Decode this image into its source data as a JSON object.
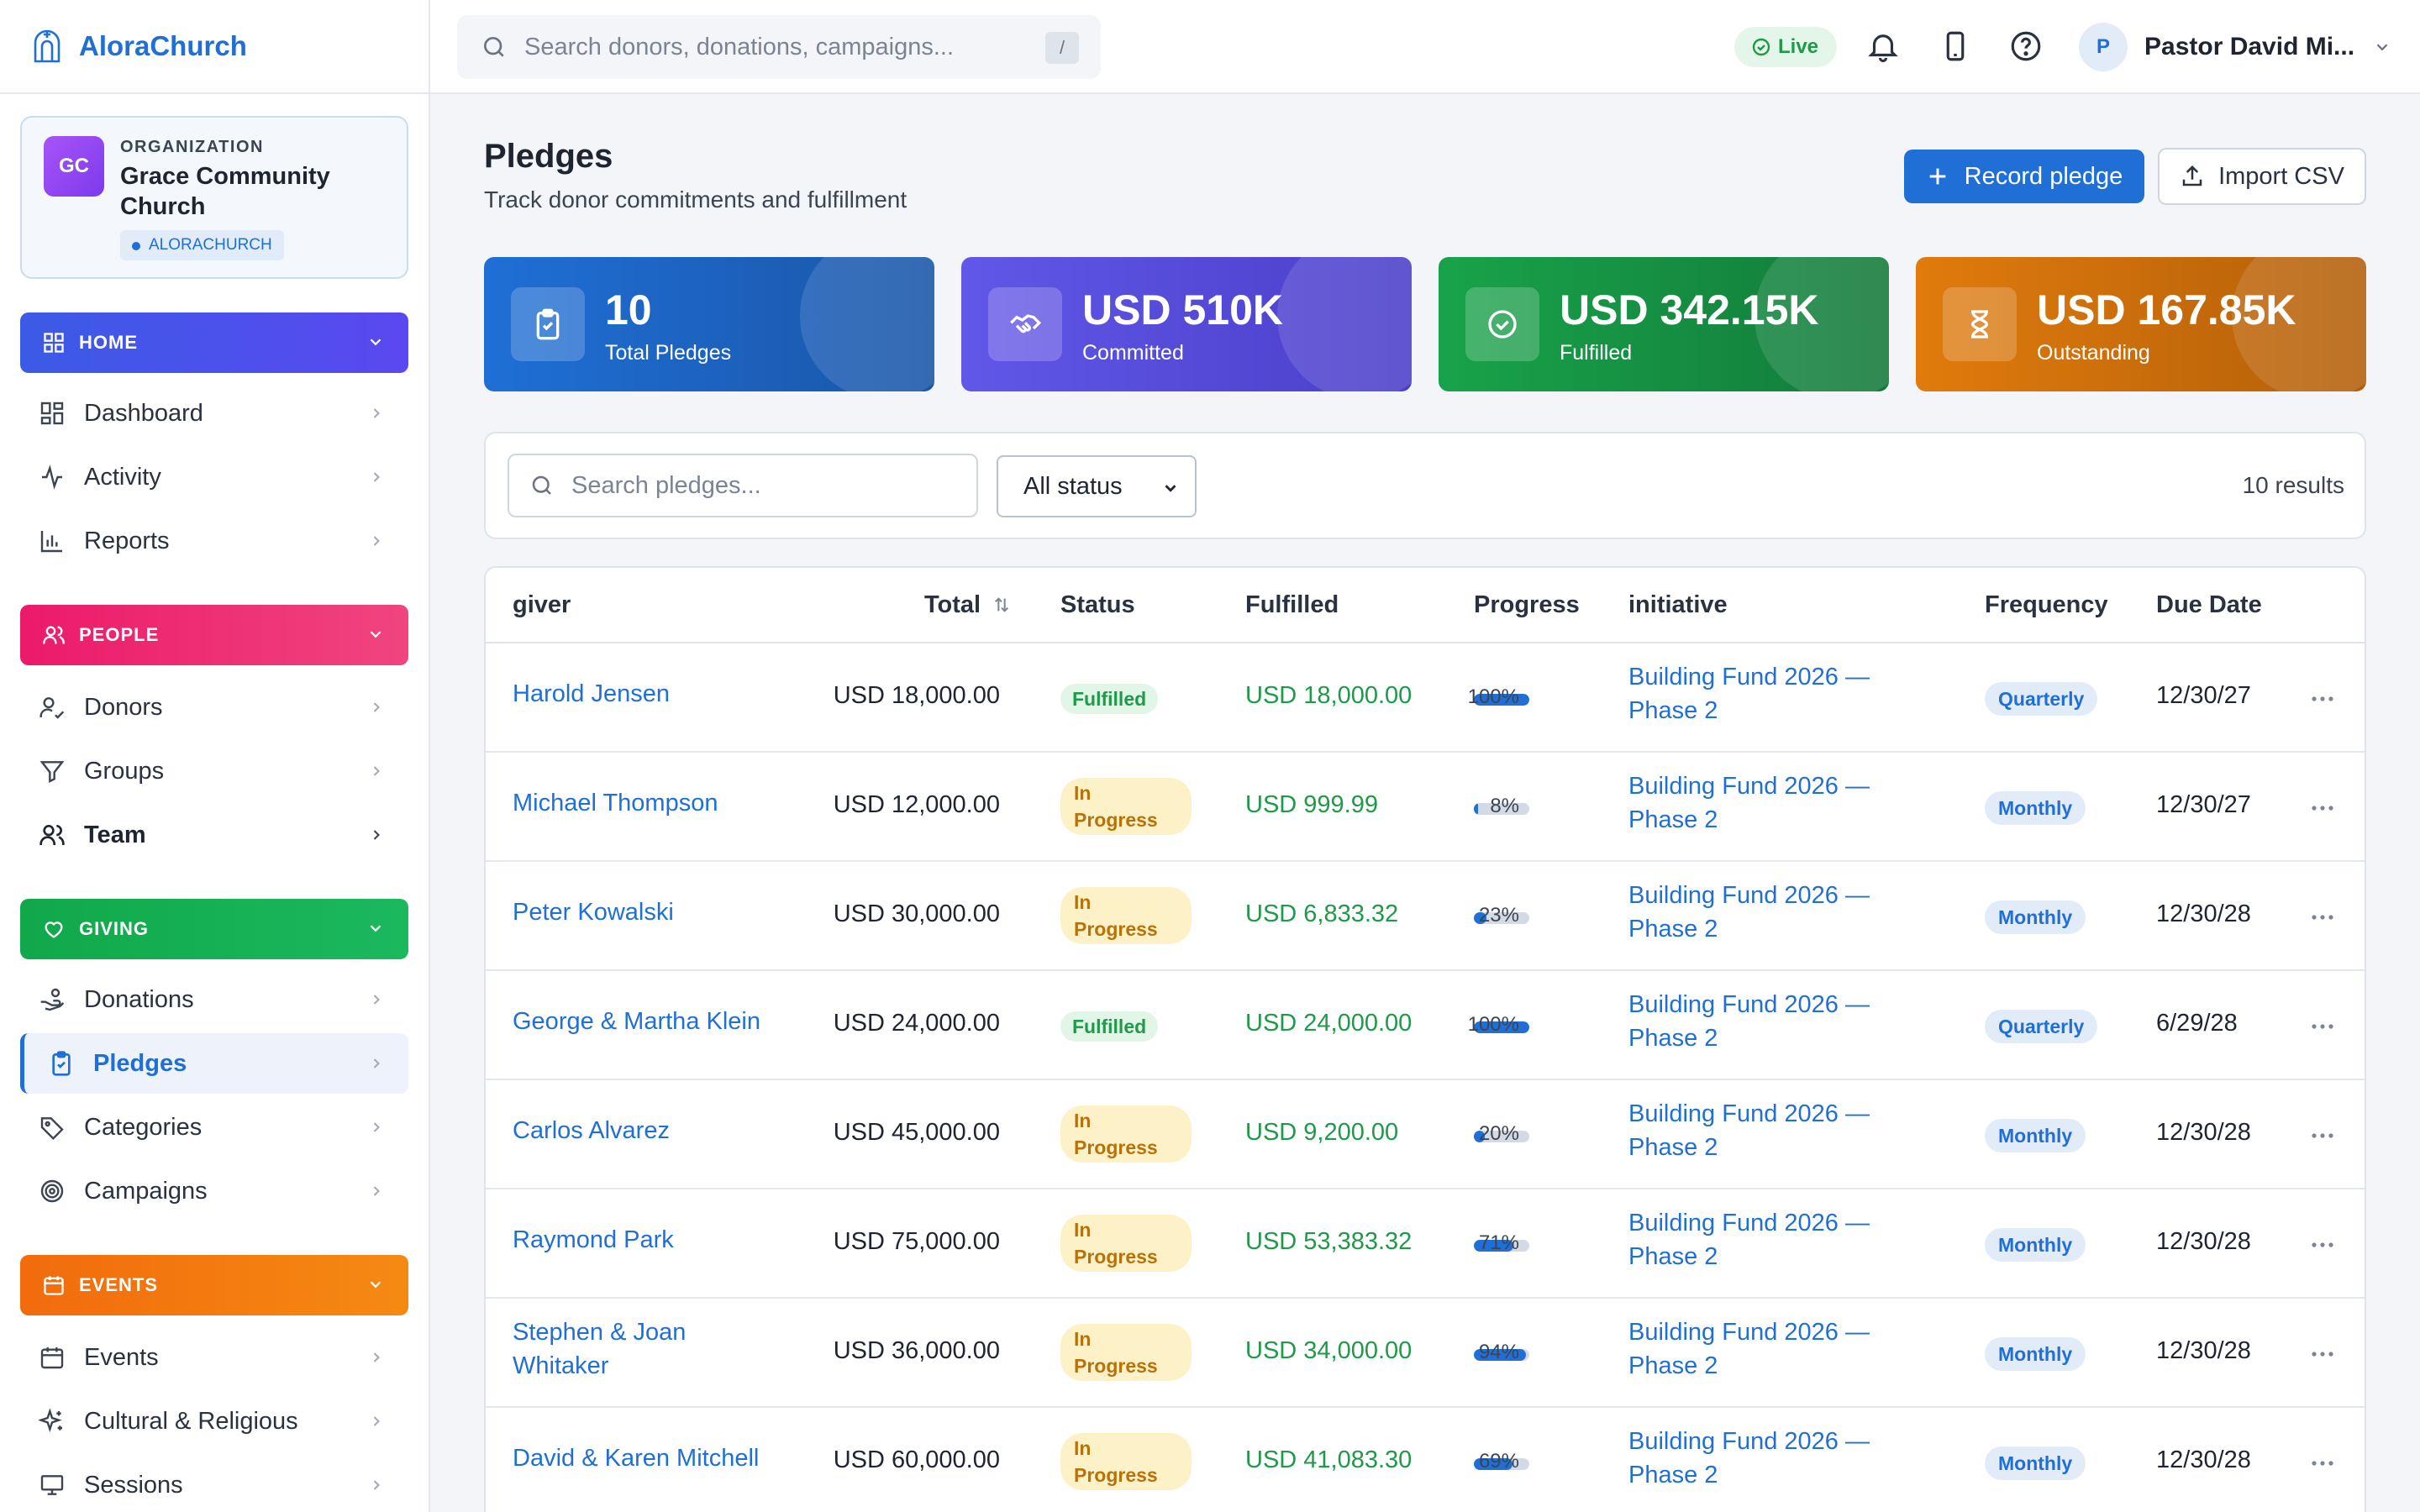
{
  "brand": {
    "name": "AloraChurch"
  },
  "org": {
    "initials": "GC",
    "label": "ORGANIZATION",
    "name": "Grace Community Church",
    "tag": "ALORACHURCH"
  },
  "sidebar": {
    "sections": [
      {
        "title": "HOME",
        "items": [
          "Dashboard",
          "Activity",
          "Reports"
        ]
      },
      {
        "title": "PEOPLE",
        "items": [
          "Donors",
          "Groups",
          "Team"
        ]
      },
      {
        "title": "GIVING",
        "items": [
          "Donations",
          "Pledges",
          "Categories",
          "Campaigns"
        ]
      },
      {
        "title": "EVENTS",
        "items": [
          "Events",
          "Cultural & Religious",
          "Sessions"
        ]
      }
    ],
    "active_item": "Pledges"
  },
  "topbar": {
    "search_placeholder": "Search donors, donations, campaigns...",
    "search_shortcut": "/",
    "live_label": "Live",
    "user_initial": "P",
    "user_name": "Pastor David Mi..."
  },
  "page": {
    "title": "Pledges",
    "subtitle": "Track donor commitments and fulfillment",
    "record_button": "Record pledge",
    "import_button": "Import CSV"
  },
  "stats": [
    {
      "value": "10",
      "label": "Total Pledges",
      "icon": "clipboard-check-icon",
      "gradient": [
        "#1f6fd6",
        "#1a56a8"
      ]
    },
    {
      "value": "USD 510K",
      "label": "Committed",
      "icon": "handshake-icon",
      "gradient": [
        "#6157e8",
        "#4a3fc9"
      ]
    },
    {
      "value": "USD 342.15K",
      "label": "Fulfilled",
      "icon": "check-circle-icon",
      "gradient": [
        "#18a34a",
        "#137a3a"
      ]
    },
    {
      "value": "USD 167.85K",
      "label": "Outstanding",
      "icon": "hourglass-icon",
      "gradient": [
        "#e07b0c",
        "#b35f0a"
      ]
    }
  ],
  "filters": {
    "search_placeholder": "Search pledges...",
    "status_value": "All status",
    "results": "10 results"
  },
  "table": {
    "headers": {
      "giver": "giver",
      "total": "Total",
      "status": "Status",
      "fulfilled": "Fulfilled",
      "progress": "Progress",
      "initiative": "initiative",
      "frequency": "Frequency",
      "due": "Due Date"
    },
    "rows": [
      {
        "giver": "Harold Jensen",
        "total": "USD 18,000.00",
        "status": "Fulfilled",
        "fulfilled": "USD 18,000.00",
        "progress": 100,
        "progress_label": "100%",
        "initiative": "Building Fund 2026 — Phase 2",
        "frequency": "Quarterly",
        "due": "12/30/27"
      },
      {
        "giver": "Michael Thompson",
        "total": "USD 12,000.00",
        "status": "In Progress",
        "fulfilled": "USD 999.99",
        "progress": 8,
        "progress_label": "8%",
        "initiative": "Building Fund 2026 — Phase 2",
        "frequency": "Monthly",
        "due": "12/30/27"
      },
      {
        "giver": "Peter Kowalski",
        "total": "USD 30,000.00",
        "status": "In Progress",
        "fulfilled": "USD 6,833.32",
        "progress": 23,
        "progress_label": "23%",
        "initiative": "Building Fund 2026 — Phase 2",
        "frequency": "Monthly",
        "due": "12/30/28"
      },
      {
        "giver": "George & Martha Klein",
        "total": "USD 24,000.00",
        "status": "Fulfilled",
        "fulfilled": "USD 24,000.00",
        "progress": 100,
        "progress_label": "100%",
        "initiative": "Building Fund 2026 — Phase 2",
        "frequency": "Quarterly",
        "due": "6/29/28"
      },
      {
        "giver": "Carlos Alvarez",
        "total": "USD 45,000.00",
        "status": "In Progress",
        "fulfilled": "USD 9,200.00",
        "progress": 20,
        "progress_label": "20%",
        "initiative": "Building Fund 2026 — Phase 2",
        "frequency": "Monthly",
        "due": "12/30/28"
      },
      {
        "giver": "Raymond Park",
        "total": "USD 75,000.00",
        "status": "In Progress",
        "fulfilled": "USD 53,383.32",
        "progress": 71,
        "progress_label": "71%",
        "initiative": "Building Fund 2026 — Phase 2",
        "frequency": "Monthly",
        "due": "12/30/28"
      },
      {
        "giver": "Stephen & Joan Whitaker",
        "total": "USD 36,000.00",
        "status": "In Progress",
        "fulfilled": "USD 34,000.00",
        "progress": 94,
        "progress_label": "94%",
        "initiative": "Building Fund 2026 — Phase 2",
        "frequency": "Monthly",
        "due": "12/30/28"
      },
      {
        "giver": "David & Karen Mitchell",
        "total": "USD 60,000.00",
        "status": "In Progress",
        "fulfilled": "USD 41,083.30",
        "progress": 69,
        "progress_label": "69%",
        "initiative": "Building Fund 2026 — Phase 2",
        "frequency": "Monthly",
        "due": "12/30/28"
      }
    ]
  }
}
